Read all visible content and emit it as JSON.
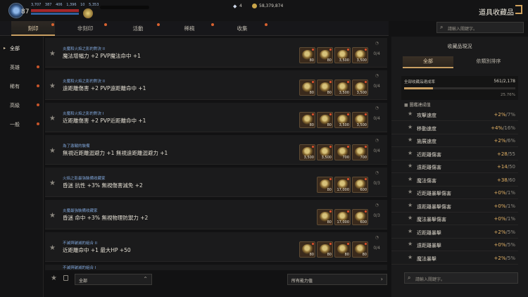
{
  "header": {
    "level": "87",
    "stat_a": "3,707",
    "stat_b": "387",
    "stat_c": "406",
    "stat_d": "1,396",
    "stat_e": "10",
    "stat_f": "5,353",
    "gem_count": "4",
    "gold": "58,379,874",
    "page_title": "道具收藏品"
  },
  "search": {
    "placeholder": "請輸入關鍵字。"
  },
  "tabs": [
    {
      "label": "刻印"
    },
    {
      "label": "非刻印"
    },
    {
      "label": "活動"
    },
    {
      "label": "稀稿"
    },
    {
      "label": "收集"
    }
  ],
  "nav": [
    {
      "label": "全部"
    },
    {
      "label": "英雄"
    },
    {
      "label": "稀有"
    },
    {
      "label": "高級"
    },
    {
      "label": "一般"
    }
  ],
  "rows": [
    {
      "cat": "炎魔和火焰之影的對決 II",
      "desc": "魔法增幅力 +2 PVP魔法命中 +1",
      "count": "0/4",
      "items": [
        "80",
        "80",
        "3,500",
        "3,500"
      ]
    },
    {
      "cat": "炎魔和火焰之影的對決 II",
      "desc": "遠距離傷害 +2 PVP遠距離命中 +1",
      "count": "0/4",
      "items": [
        "80",
        "80",
        "3,500",
        "3,500"
      ]
    },
    {
      "cat": "炎魔和火焰之影的對決 I",
      "desc": "近距離傷害 +2 PVP近距離命中 +1",
      "count": "0/4",
      "items": [
        "80",
        "80",
        "3,500",
        "3,500"
      ]
    },
    {
      "cat": "為了激戰的裝備",
      "desc": "無視近距離迴避力 +1 無視遠距離迴避力 +1",
      "count": "0/4",
      "items": [
        "3,500",
        "3,500",
        "700",
        "700"
      ]
    },
    {
      "cat": "火焰之影最強裝備收藏家",
      "desc": "昏迷 抗性 +3% 無視傷害減免 +2",
      "count": "0/3",
      "items": [
        "80",
        "17,000",
        "600"
      ]
    },
    {
      "cat": "炎魔最強裝備收藏家",
      "desc": "昏迷 命中 +3% 無視物理防禦力 +2",
      "count": "0/3",
      "items": [
        "80",
        "17,000",
        "600"
      ]
    },
    {
      "cat": "不滅與破滅的組合 II",
      "desc": "近距離命中 +1 最大HP +50",
      "count": "0/4",
      "items": [
        "80",
        "80",
        "80",
        "80"
      ]
    },
    {
      "cat": "不滅與破滅的組合 I",
      "desc": "",
      "count": "",
      "items": []
    }
  ],
  "filters": {
    "left_select": "全部",
    "right_select": "所有能力值"
  },
  "collection": {
    "panel_title": "收藏品現況",
    "tab_all": "全部",
    "tab_sort": "依類別排序",
    "rate_label": "全部收藏品達成率",
    "rate_value": "561/2,178",
    "rate_percent": "25.76%",
    "progress": 0.2576,
    "section_label": "圖鑑達成值",
    "stats": [
      {
        "name": "攻擊速度",
        "val": "+2%",
        "max": "/7%"
      },
      {
        "name": "移動速度",
        "val": "+4%",
        "max": "/16%"
      },
      {
        "name": "施展速度",
        "val": "+2%",
        "max": "/6%"
      },
      {
        "name": "近距離傷害",
        "val": "+28",
        "max": "/55"
      },
      {
        "name": "遠距離傷害",
        "val": "+14",
        "max": "/50"
      },
      {
        "name": "魔法傷害",
        "val": "+38",
        "max": "/60"
      },
      {
        "name": "近距離暴擊傷害",
        "val": "+0%",
        "max": "/1%"
      },
      {
        "name": "遠距離暴擊傷害",
        "val": "+0%",
        "max": "/1%"
      },
      {
        "name": "魔法暴擊傷害",
        "val": "+0%",
        "max": "/1%"
      },
      {
        "name": "近距離暴擊",
        "val": "+2%",
        "max": "/5%"
      },
      {
        "name": "遠距離暴擊",
        "val": "+0%",
        "max": "/5%"
      },
      {
        "name": "魔法暴擊",
        "val": "+2%",
        "max": "/5%"
      }
    ]
  },
  "colors": {
    "accent": "#c99f63",
    "alert": "#d8612f",
    "category": "#7ea4d8",
    "stat_value": "#e6b466"
  }
}
